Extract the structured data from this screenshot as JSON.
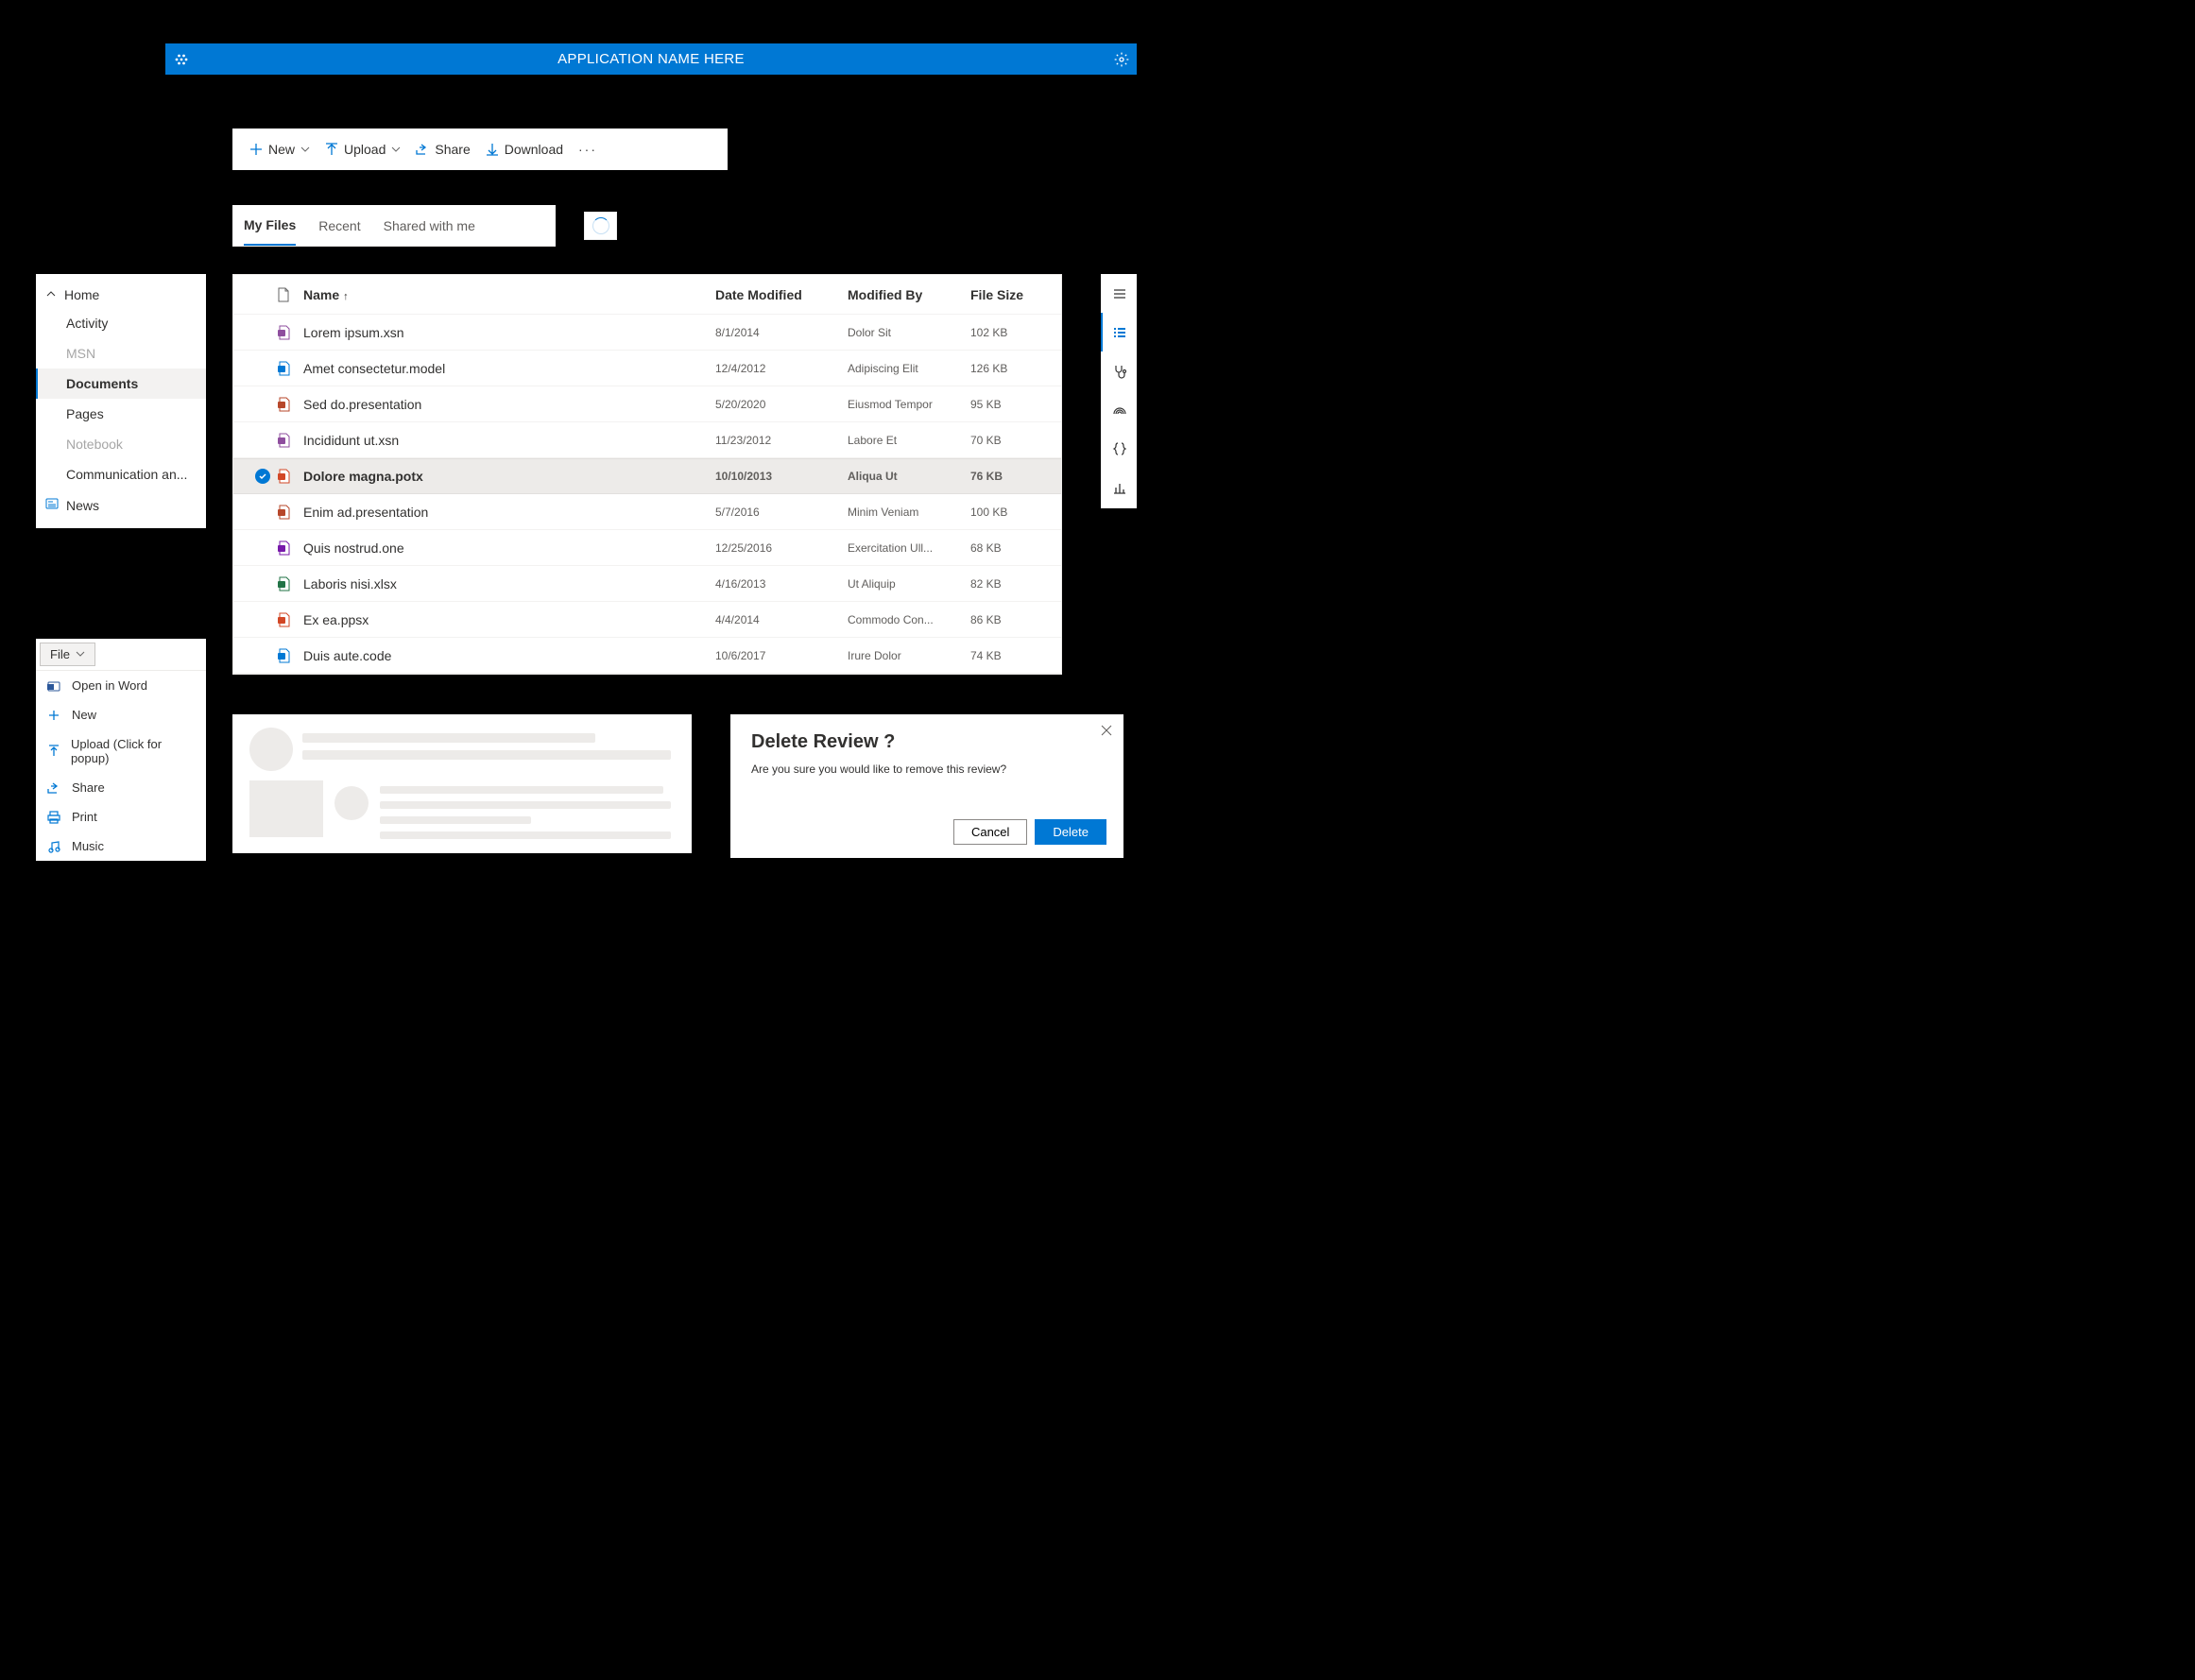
{
  "header": {
    "title": "APPLICATION NAME HERE"
  },
  "commandBar": {
    "new": "New",
    "upload": "Upload",
    "share": "Share",
    "download": "Download"
  },
  "tabs": [
    {
      "label": "My Files",
      "selected": true
    },
    {
      "label": "Recent",
      "selected": false
    },
    {
      "label": "Shared with me",
      "selected": false
    }
  ],
  "sideNav": {
    "home": "Home",
    "items": [
      {
        "label": "Activity",
        "disabled": false
      },
      {
        "label": "MSN",
        "disabled": true
      },
      {
        "label": "Documents",
        "disabled": false,
        "selected": true
      },
      {
        "label": "Pages",
        "disabled": false
      },
      {
        "label": "Notebook",
        "disabled": true
      },
      {
        "label": "Communication an...",
        "disabled": false
      }
    ],
    "news": "News"
  },
  "fileTable": {
    "columns": {
      "name": "Name",
      "dateModified": "Date Modified",
      "modifiedBy": "Modified By",
      "fileSize": "File Size"
    },
    "rows": [
      {
        "icon": "infopath",
        "name": "Lorem ipsum.xsn",
        "date": "8/1/2014",
        "mod": "Dolor Sit",
        "size": "102 KB",
        "selected": false
      },
      {
        "icon": "model",
        "name": "Amet consectetur.model",
        "date": "12/4/2012",
        "mod": "Adipiscing Elit",
        "size": "126 KB",
        "selected": false
      },
      {
        "icon": "presentation",
        "name": "Sed do.presentation",
        "date": "5/20/2020",
        "mod": "Eiusmod Tempor",
        "size": "95 KB",
        "selected": false
      },
      {
        "icon": "infopath",
        "name": "Incididunt ut.xsn",
        "date": "11/23/2012",
        "mod": "Labore Et",
        "size": "70 KB",
        "selected": false
      },
      {
        "icon": "powerpoint",
        "name": "Dolore magna.potx",
        "date": "10/10/2013",
        "mod": "Aliqua Ut",
        "size": "76 KB",
        "selected": true
      },
      {
        "icon": "presentation",
        "name": "Enim ad.presentation",
        "date": "5/7/2016",
        "mod": "Minim Veniam",
        "size": "100 KB",
        "selected": false
      },
      {
        "icon": "onenote",
        "name": "Quis nostrud.one",
        "date": "12/25/2016",
        "mod": "Exercitation Ull...",
        "size": "68 KB",
        "selected": false
      },
      {
        "icon": "excel",
        "name": "Laboris nisi.xlsx",
        "date": "4/16/2013",
        "mod": "Ut Aliquip",
        "size": "82 KB",
        "selected": false
      },
      {
        "icon": "ppsx",
        "name": "Ex ea.ppsx",
        "date": "4/4/2014",
        "mod": "Commodo Con...",
        "size": "86 KB",
        "selected": false
      },
      {
        "icon": "code",
        "name": "Duis aute.code",
        "date": "10/6/2017",
        "mod": "Irure Dolor",
        "size": "74 KB",
        "selected": false
      }
    ]
  },
  "fileMenu": {
    "button": "File",
    "items": [
      {
        "label": "Open in Word",
        "icon": "word"
      },
      {
        "label": "New",
        "icon": "plus"
      },
      {
        "label": "Upload (Click for popup)",
        "icon": "upload"
      },
      {
        "label": "Share",
        "icon": "share"
      },
      {
        "label": "Print",
        "icon": "print"
      },
      {
        "label": "Music",
        "icon": "music"
      }
    ]
  },
  "dialog": {
    "title": "Delete Review ?",
    "body": "Are you sure you would like to remove this review?",
    "cancel": "Cancel",
    "confirm": "Delete"
  }
}
